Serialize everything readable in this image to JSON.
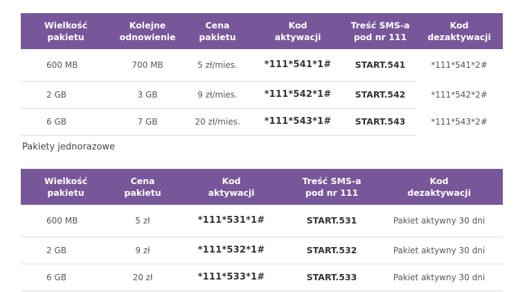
{
  "table1": {
    "headers": [
      [
        "Wielkość",
        "pakietu"
      ],
      [
        "Kolejne",
        "odnowienie"
      ],
      [
        "Cena",
        "pakietu"
      ],
      [
        "Kod",
        "aktywacji"
      ],
      [
        "Treść SMS-a",
        "pod nr 111"
      ],
      [
        "Kod",
        "dezaktywacji"
      ]
    ],
    "rows": [
      [
        "600 MB",
        "700 MB",
        "5 zł/mies.",
        "*111*541*1#",
        "START.541",
        "*111*541*2#"
      ],
      [
        "2 GB",
        "3 GB",
        "9 zł/mies.",
        "*111*542*1#",
        "START.542",
        "*111*542*2#"
      ],
      [
        "6 GB",
        "7 GB",
        "20 zł/mies.",
        "*111*543*1#",
        "START.543",
        "*111*543*2#"
      ]
    ]
  },
  "section_label": "Pakiety jednorazowe",
  "table2": {
    "headers": [
      [
        "Wielkość",
        "pakietu"
      ],
      [
        "Cena",
        "pakietu"
      ],
      [
        "Kod",
        "aktywacji"
      ],
      [
        "Treść SMS-a",
        "pod nr 111"
      ],
      [
        "Kod",
        "dezaktywacji"
      ]
    ],
    "rows": [
      [
        "600 MB",
        "5 zł",
        "*111*531*1#",
        "START.531",
        "Pakiet aktywny 30 dni"
      ],
      [
        "2 GB",
        "9 zł",
        "*111*532*1#",
        "START.532",
        "Pakiet aktywny 30 dni"
      ],
      [
        "6 GB",
        "20 zł",
        "*111*533*1#",
        "START.533",
        "Pakiet aktywny 30 dni"
      ]
    ]
  },
  "colors": {
    "header_bg": "#77569a",
    "header_text": "#ffffff",
    "row_divider": "#dcdcdc"
  }
}
